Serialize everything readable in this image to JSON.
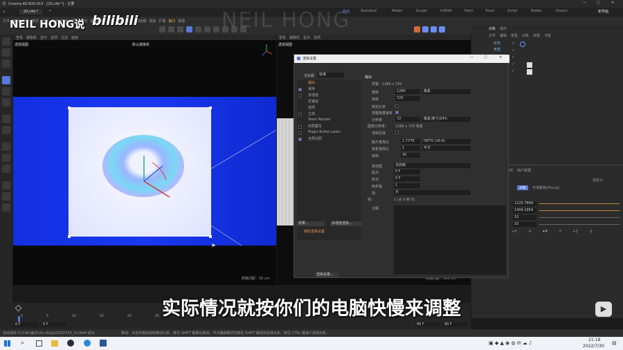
{
  "window": {
    "title": "Cinema 4D R26.013 - [20.c4d *] - 主要"
  },
  "tab": {
    "label": "20.c4d *"
  },
  "watermark": {
    "brand": "NEIL HONG说",
    "platform": "bilibili",
    "faint": "NEIL HONG"
  },
  "menu": [
    "文件",
    "编辑",
    "创建",
    "模式",
    "选择",
    "工具",
    "样条",
    "网格",
    "体积",
    "运动图形",
    "角色",
    "动画",
    "模拟",
    "跟踪器",
    "渲染",
    "扩展",
    "窗口",
    "帮助"
  ],
  "layout_tabs": [
    "启动",
    "Standard",
    "Model",
    "Sculpt",
    "UVEdit",
    "Paint",
    "Track",
    "Script",
    "Nodes",
    "Groom"
  ],
  "new_layout": "新界面",
  "viewport1": {
    "name": "透视视图",
    "camera": "默认摄像机",
    "grid": "网格间距：50 cm",
    "move_label": "移动"
  },
  "viewport2": {
    "name": "透视视图",
    "grid": "网格间距：500 cm"
  },
  "viewport_menu": [
    "查看",
    "摄像机",
    "显示",
    "选项",
    "过滤",
    "面板"
  ],
  "object_panel": {
    "tabs": [
      "对象",
      "场次"
    ],
    "menu": [
      "文件",
      "编辑",
      "查看",
      "对象",
      "标签",
      "书签"
    ],
    "items": [
      "灯光",
      "天空"
    ]
  },
  "attr_panel": {
    "header": "模式",
    "section": "用户数据",
    "obj_label": "对象",
    "shading": "平滑着色(Phong)",
    "values": [
      "1220.7899",
      "1404.1954",
      "10",
      "10"
    ],
    "axes": [
      "+X",
      "-X",
      "+Y",
      "-Y",
      "+Z",
      "-Z"
    ],
    "custom": "自定义"
  },
  "dialog": {
    "title": "渲染设置",
    "renderer_label": "渲染器",
    "renderer": "标准",
    "left_items": [
      "输出",
      "保存",
      "多通道",
      "抗锯齿",
      "选项",
      "立体",
      "Team Render",
      "材质覆写",
      "Magic Bullet Looks",
      "全局光照"
    ],
    "left_checks": [
      false,
      true,
      false,
      false,
      false,
      false,
      false,
      false,
      false,
      true
    ],
    "section": "输出",
    "preset": "预置：1280 x 720",
    "width_label": "宽度",
    "width": "1280",
    "width_unit": "像素",
    "height_label": "高度",
    "height": "720",
    "lock_ratio": "锁定比率",
    "adapt_label": "调整数据速率",
    "res_label": "分辨率",
    "res": "72",
    "res_unit": "像素/英寸(DPI)",
    "img_res_label": "图像分辨率：",
    "img_res": "1280 x 720 像素",
    "region_label": "渲染区域",
    "film_ratio_label": "胶片宽高比",
    "film_ratio": "1.7778",
    "film_ratio_name": "HDTV (16:9)",
    "pixel_ratio_label": "像素宽高比",
    "pixel_ratio": "1",
    "pixel_ratio_name": "平方",
    "fps_label": "帧频",
    "fps": "30",
    "frame_range_label": "帧范围",
    "frame_range": "当前帧",
    "start_label": "起点",
    "start": "0 F",
    "end_label": "终点",
    "end": "0 F",
    "step_label": "帧步幅",
    "step": "1",
    "field_label": "场",
    "field": "无",
    "frames_label": "帧：",
    "frames": "1 (从 0 到 0)",
    "notes_label": "注释",
    "effects_btn": "效果...",
    "multi_btn": "多通道渲染...",
    "my_settings": "我的渲染设置",
    "render_settings_btn": "渲染设置..."
  },
  "timeline": {
    "ticks": [
      "0",
      "5",
      "10",
      "15",
      "20",
      "25"
    ],
    "start": "0 F",
    "current": "0 F",
    "end1": "90 F",
    "end2": "90 F"
  },
  "status": {
    "left": "自动保存 K:\\C4D\\备份\\20.c4d@20220730_211844 成功",
    "right": "移动：点击并拖动鼠标移动元素。按住 SHIFT 键量化移动；节点编辑模式时按住 SHIFT 键增加选择对象；按住 CTRL 键减少选择对象。"
  },
  "subtitle": "实际情况就按你们的电脑快慢来调整",
  "clock": {
    "time": "21:18",
    "date": "2022/7/30"
  }
}
